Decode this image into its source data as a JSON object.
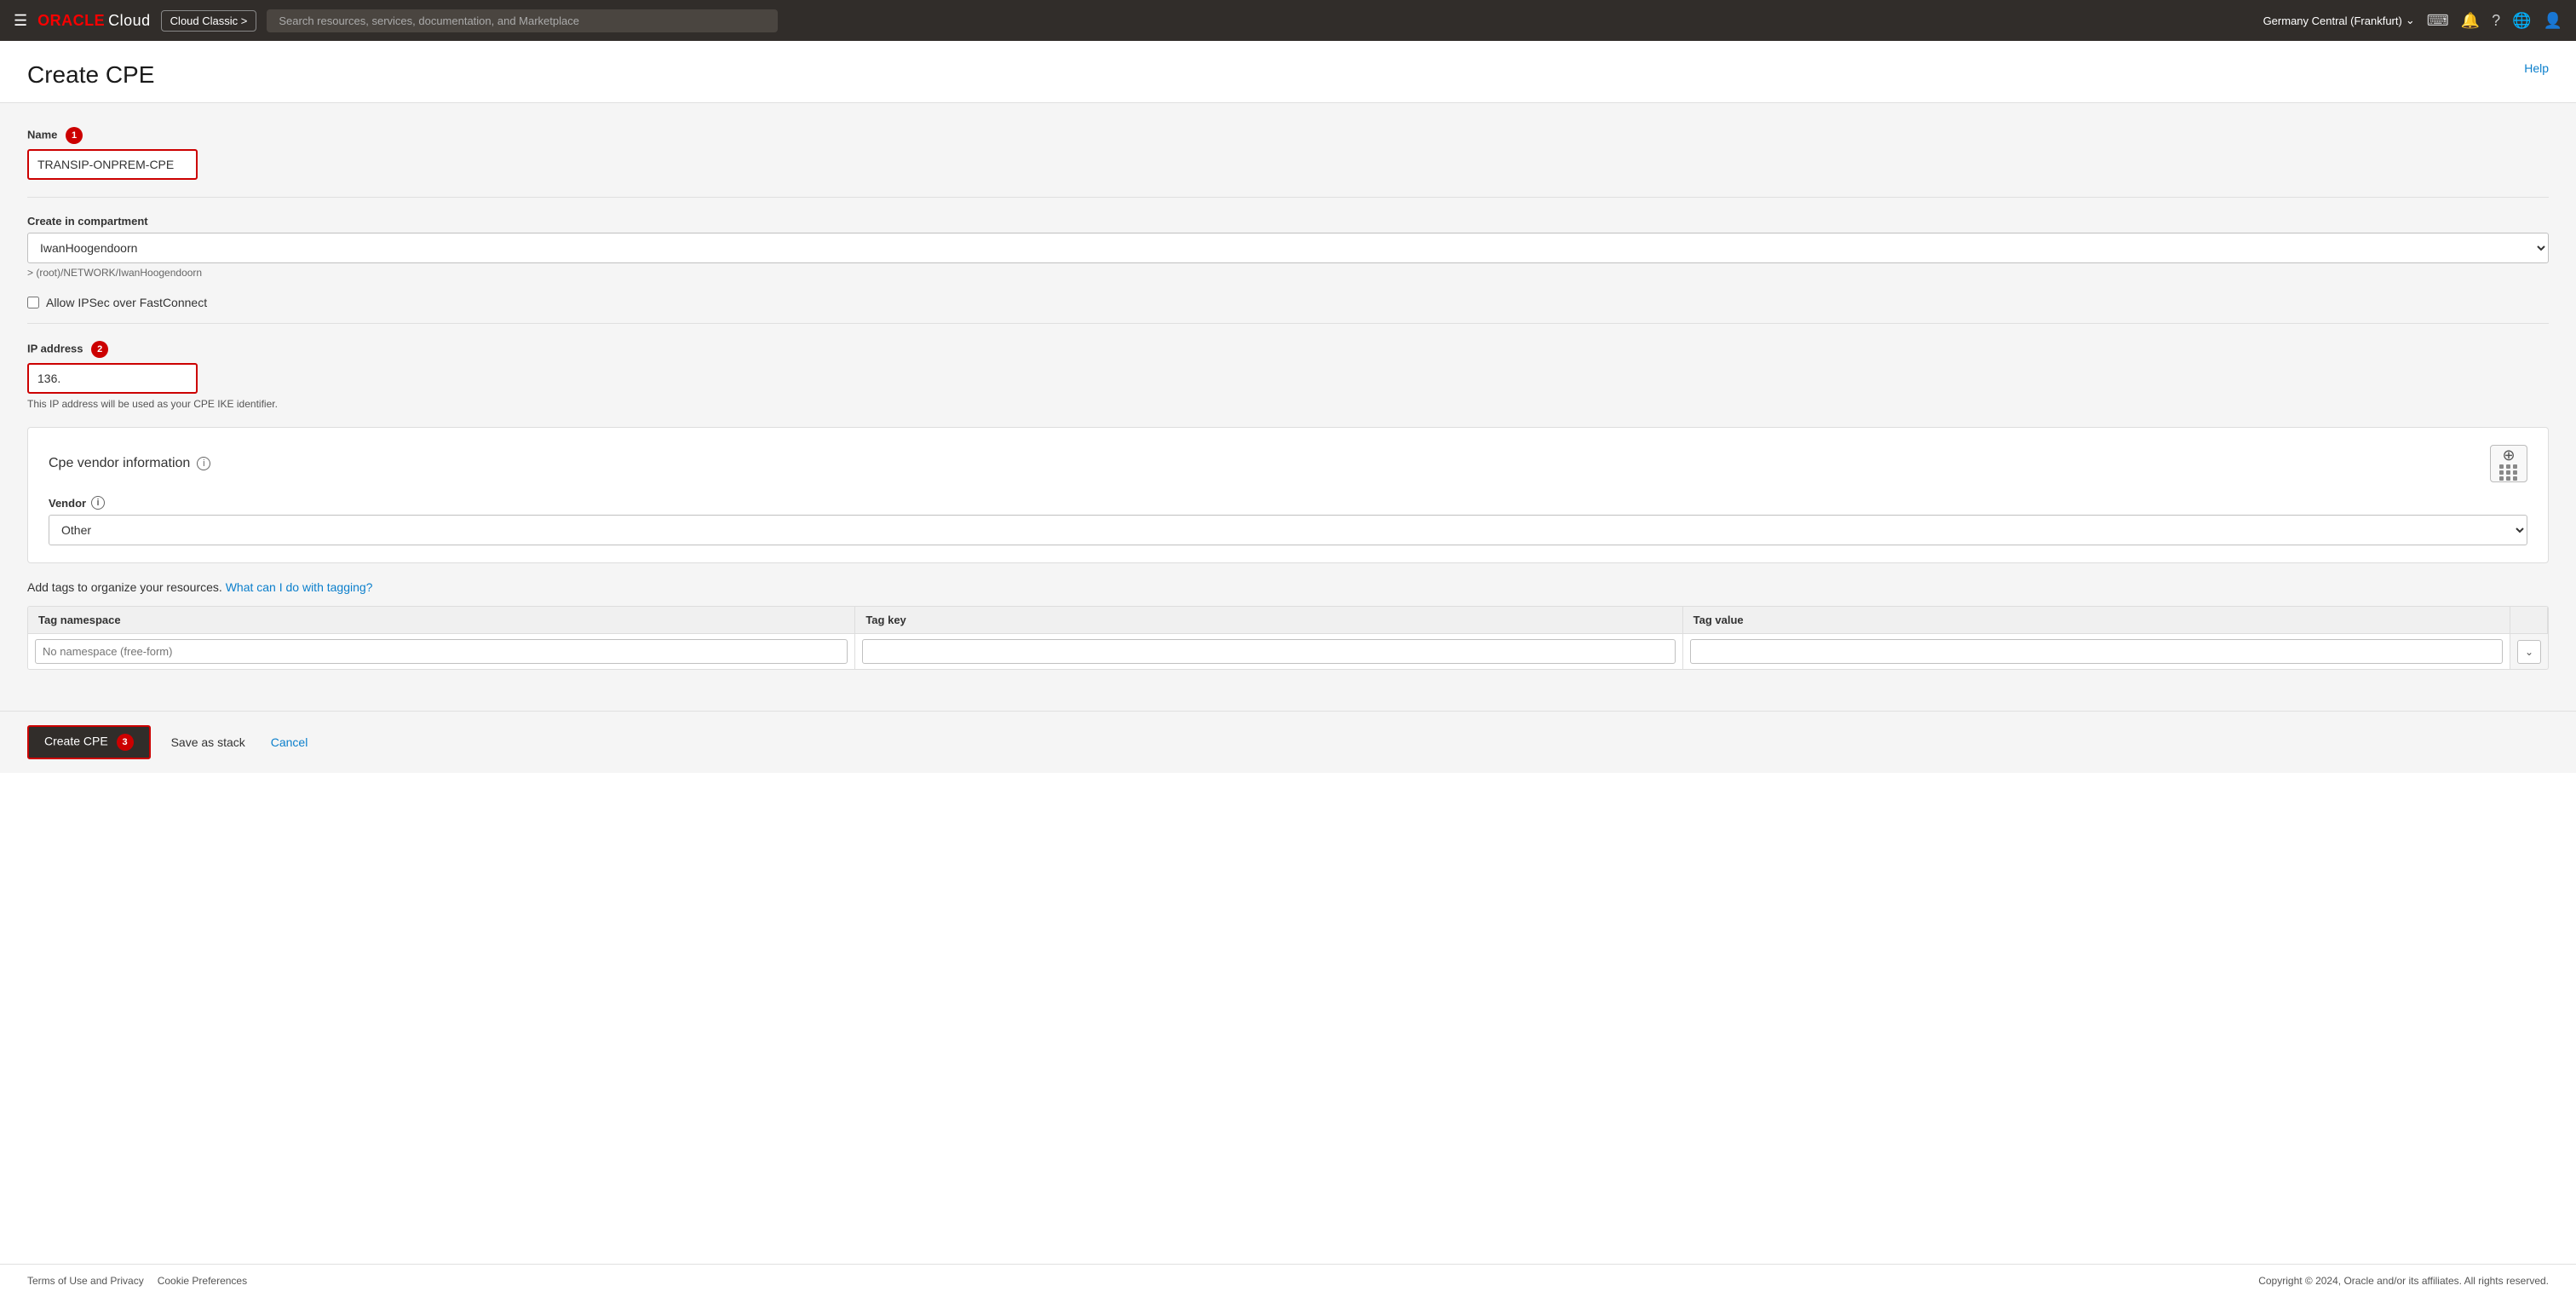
{
  "topnav": {
    "hamburger_label": "☰",
    "logo_oracle": "ORACLE",
    "logo_cloud": "Cloud",
    "cloud_classic_label": "Cloud Classic >",
    "search_placeholder": "Search resources, services, documentation, and Marketplace",
    "region_label": "Germany Central (Frankfurt)",
    "region_chevron": "⌄",
    "icon_terminal": "⌨",
    "icon_bell": "🔔",
    "icon_help": "?",
    "icon_globe": "🌐",
    "icon_user": "👤"
  },
  "page": {
    "title": "Create CPE",
    "help_label": "Help"
  },
  "form": {
    "name_label": "Name",
    "name_badge": "1",
    "name_value": "TRANSIP-ONPREM-CPE",
    "compartment_label": "Create in compartment",
    "compartment_value": "IwanHoogendoorn",
    "compartment_hint": "> (root)/NETWORK/IwanHoogendoorn",
    "ipsec_checkbox_label": "Allow IPSec over FastConnect",
    "ip_label": "IP address",
    "ip_badge": "2",
    "ip_value": "136.",
    "ip_hint": "This IP address will be used as your CPE IKE identifier.",
    "vendor_section_title": "Cpe vendor information",
    "vendor_label": "Vendor",
    "vendor_info_icon": "i",
    "vendor_section_info": "i",
    "vendor_value": "Other",
    "tags_intro": "Add tags to organize your resources.",
    "tags_link": "What can I do with tagging?",
    "tag_namespace_label": "Tag namespace",
    "tag_namespace_placeholder": "No namespace (free-form)",
    "tag_key_label": "Tag key",
    "tag_value_label": "Tag value"
  },
  "buttons": {
    "create_cpe_label": "Create CPE",
    "save_as_stack_label": "Save as stack",
    "cancel_label": "Cancel",
    "create_badge": "3"
  },
  "footer": {
    "terms_label": "Terms of Use and Privacy",
    "cookies_label": "Cookie Preferences",
    "copyright": "Copyright © 2024, Oracle and/or its affiliates. All rights reserved."
  }
}
